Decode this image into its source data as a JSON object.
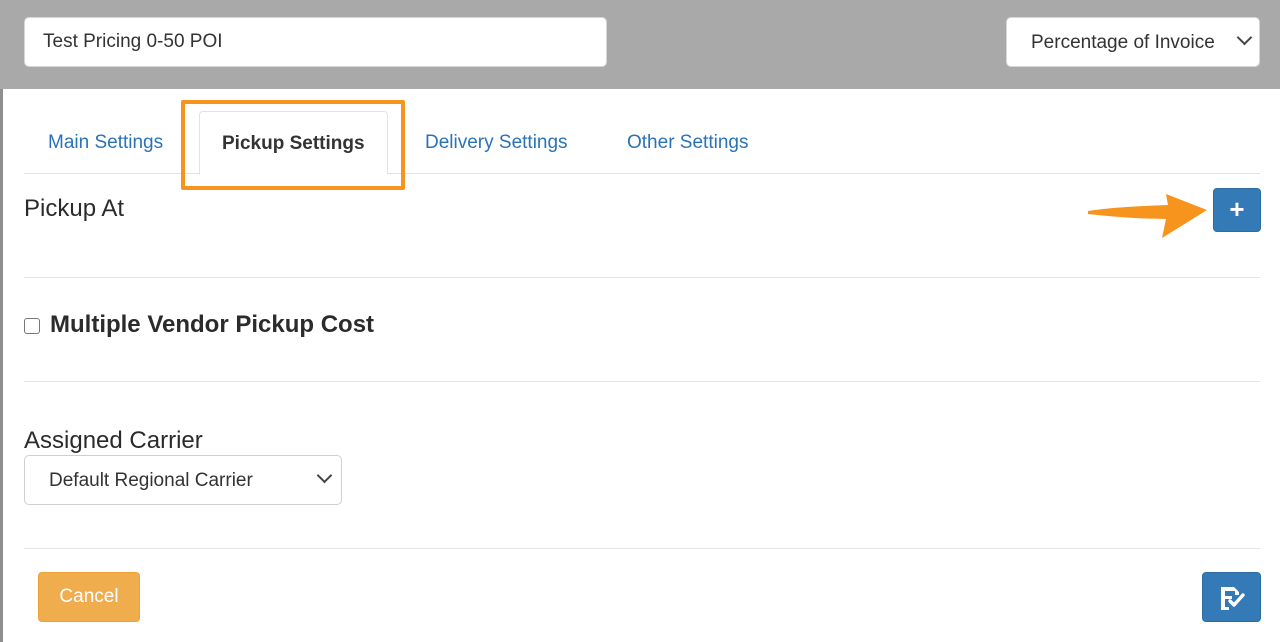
{
  "header": {
    "name_value": "Test Pricing 0-50 POI",
    "type_select_value": "Percentage of Invoice"
  },
  "tabs": [
    {
      "label": "Main Settings",
      "active": false
    },
    {
      "label": "Pickup Settings",
      "active": true
    },
    {
      "label": "Delivery Settings",
      "active": false
    },
    {
      "label": "Other Settings",
      "active": false
    }
  ],
  "pickup_at": {
    "title": "Pickup At",
    "add_icon": "plus-icon"
  },
  "multiple_vendor": {
    "label": "Multiple Vendor Pickup Cost",
    "checked": false
  },
  "assigned_carrier": {
    "title": "Assigned Carrier",
    "value": "Default Regional Carrier"
  },
  "footer": {
    "cancel_label": "Cancel",
    "save_icon": "save-check-icon"
  },
  "annotations": {
    "highlight_color": "#f7941d",
    "arrow_icon": "arrow-right-icon"
  },
  "colors": {
    "primary": "#337ab7",
    "warning": "#f0ad4e",
    "link": "#2a73b8",
    "header_bg": "#a9a9a9"
  }
}
